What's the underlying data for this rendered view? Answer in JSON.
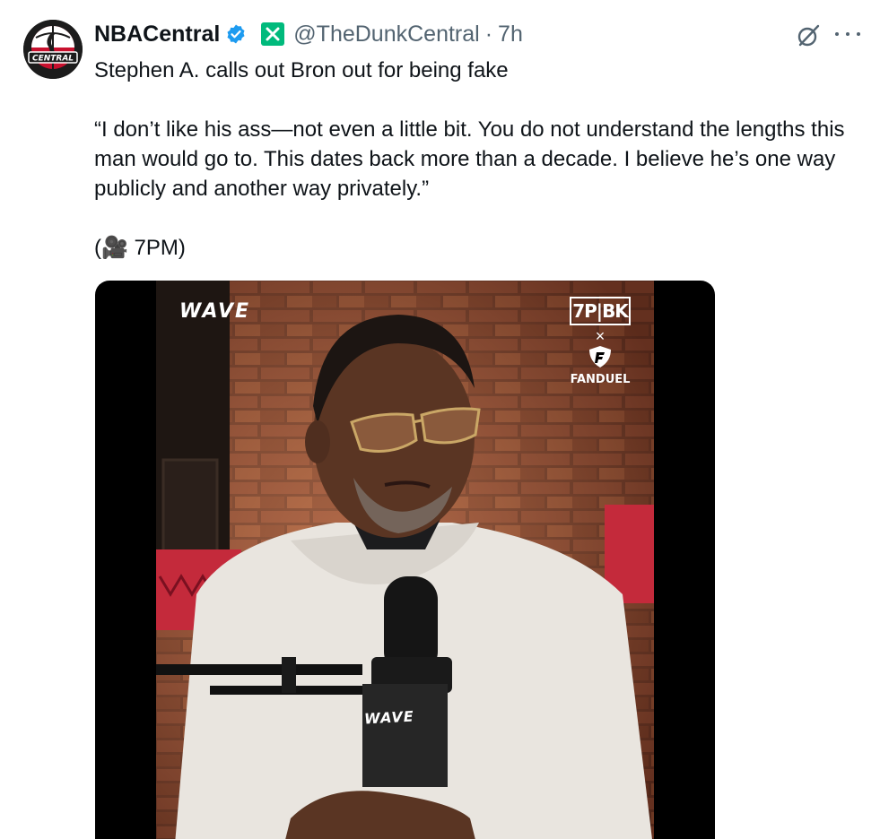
{
  "author": {
    "display_name": "NBACentral",
    "handle": "@TheDunkCentral",
    "separator": "·",
    "time": "7h",
    "avatar_text": "CENTRAL"
  },
  "tweet": {
    "line1": "Stephen A. calls out Bron out for being fake",
    "line2": "“I don’t like his ass—not even a little bit. You do not understand the lengths this man would go to. This dates back more than a decade. I believe he’s one way publicly and another way privately.”",
    "line3": "(🎥 7PM)"
  },
  "media": {
    "brand_top_left": "WAVE",
    "sponsor_logo": "7P|BK",
    "sponsor_x": "×",
    "sponsor_name": "FANDUEL",
    "mic_brand": "WAVE"
  },
  "icons": {
    "verified": "verified-badge-icon",
    "affiliate": "affiliate-x-badge-icon",
    "grok": "grok-icon",
    "more": "more-options-icon"
  },
  "colors": {
    "verified_blue": "#1d9bf0",
    "affiliate_green": "#00ba7c",
    "text_primary": "#0f1419",
    "text_secondary": "#536471"
  }
}
